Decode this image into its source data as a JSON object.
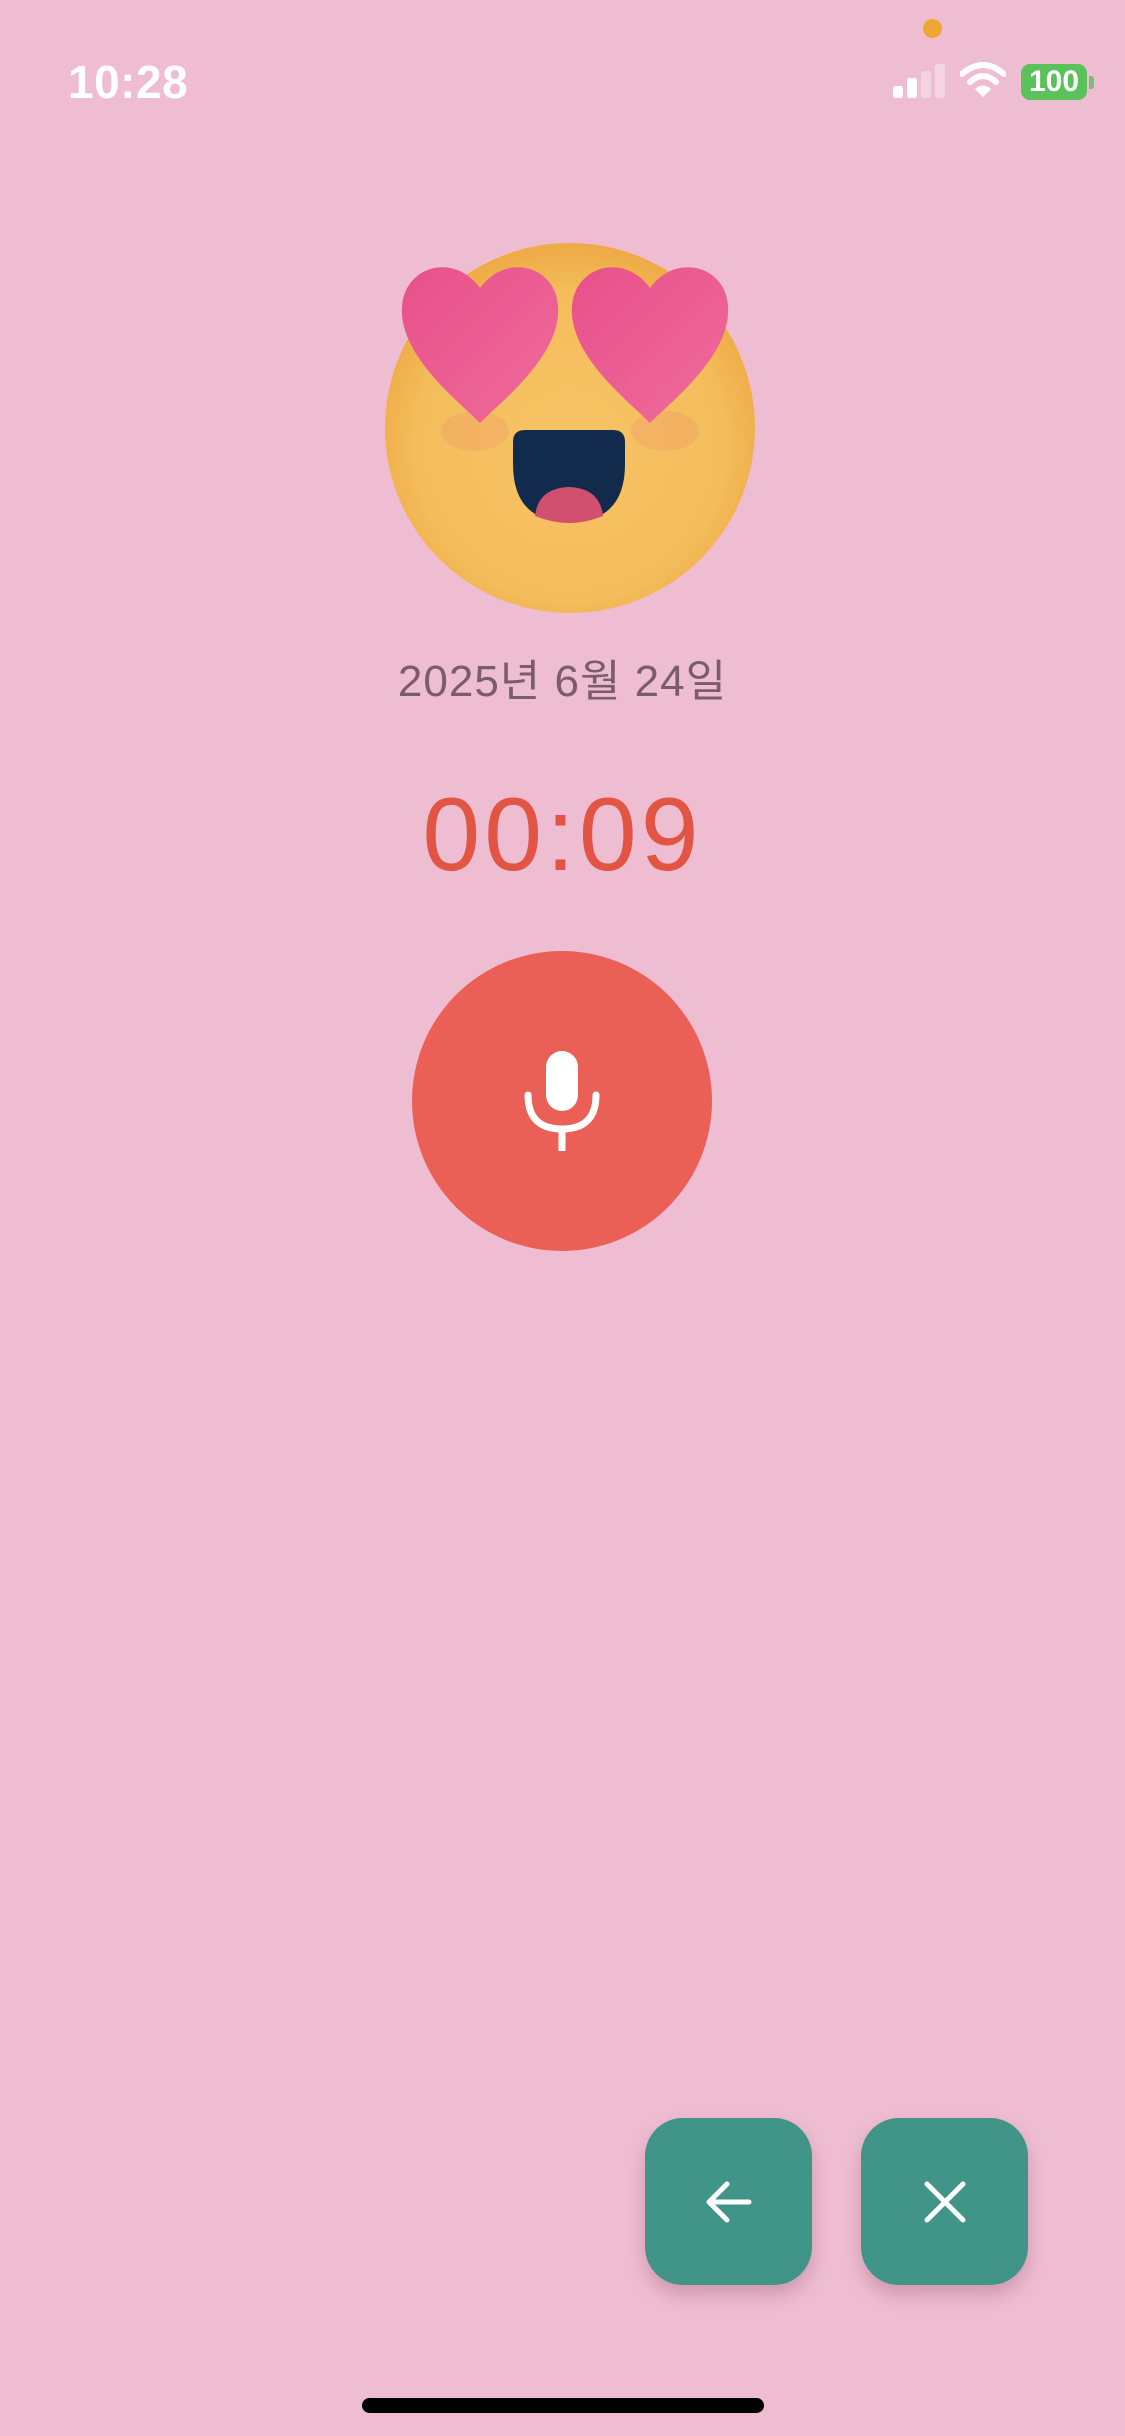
{
  "status_bar": {
    "time": "10:28",
    "battery_level": "100",
    "icons": [
      "cellular-signal-icon",
      "wifi-icon",
      "battery-icon"
    ]
  },
  "mood": {
    "icon": "heart-eyes-emoji-icon"
  },
  "recording": {
    "date": "2025년 6월 24일",
    "elapsed": "00:09",
    "record_icon": "microphone-icon"
  },
  "actions": {
    "back_icon": "arrow-left-icon",
    "close_icon": "close-icon"
  },
  "colors": {
    "background": "#efbdd1",
    "timer": "#e25444",
    "record_button": "#ea6056",
    "fab": "#419488",
    "battery": "#5ac15b"
  }
}
